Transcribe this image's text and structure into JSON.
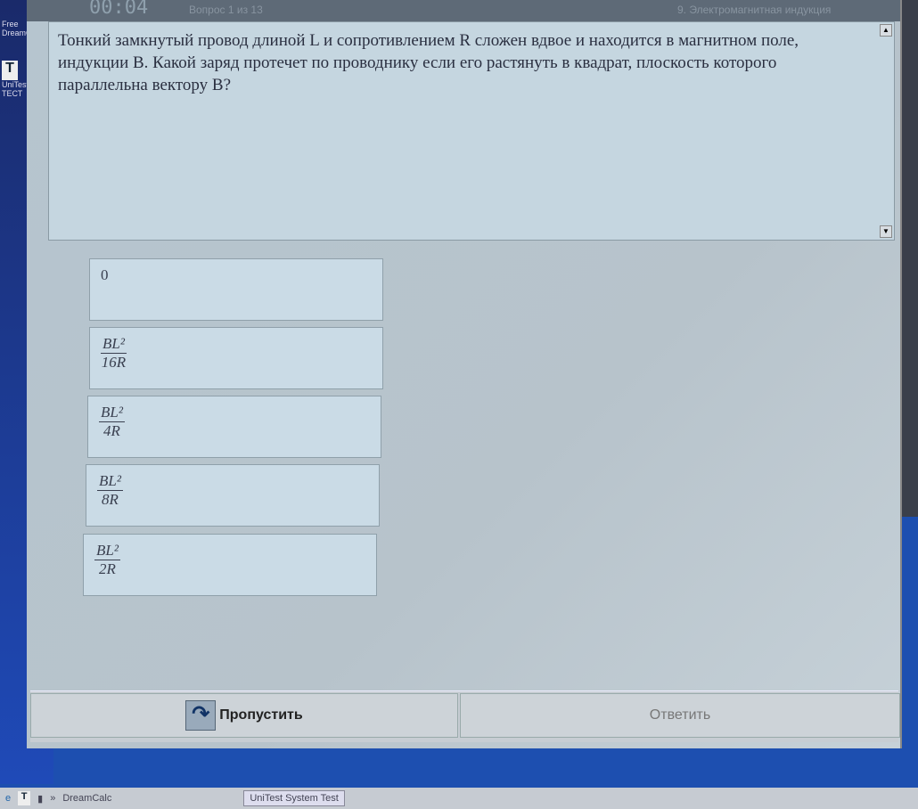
{
  "desktop": {
    "icons": [
      {
        "label": "Free DreamCalc"
      },
      {
        "label": "UniTest ТЕСТ"
      }
    ]
  },
  "header": {
    "timer": "00:04",
    "question_counter": "Вопрос 1 из 13",
    "topic": "9. Электромагнитная индукция"
  },
  "question": {
    "text": "Тонкий замкнутый провод длиной L и сопротивлением R сложен вдвое и находится в магнитном поле, индукции B. Какой заряд протечет по проводнику если его растянуть в квадрат, плоскость которого параллельна вектору B?"
  },
  "answers": [
    {
      "plain": "0"
    },
    {
      "num": "BL²",
      "den": "16R"
    },
    {
      "num": "BL²",
      "den": "4R"
    },
    {
      "num": "BL²",
      "den": "8R"
    },
    {
      "num": "BL²",
      "den": "2R"
    }
  ],
  "buttons": {
    "skip": "Пропустить",
    "answer": "Ответить"
  },
  "taskbar": {
    "quick": "DreamCalc",
    "task": "UniTest System Test"
  }
}
